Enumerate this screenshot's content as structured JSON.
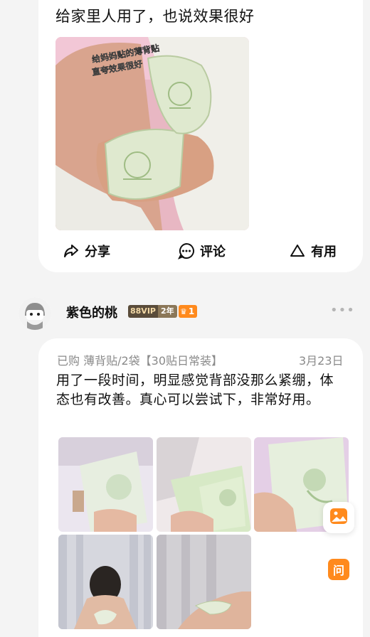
{
  "review1": {
    "text": "给家里人用了，也说效果很好",
    "photo_caption": "给妈妈贴的薄背贴 直夸效果很好"
  },
  "actions": {
    "share": "分享",
    "comment": "评论",
    "useful": "有用"
  },
  "reviewer": {
    "name": "紫色的桃",
    "vip": "88VIP",
    "years": "2年",
    "level": "1"
  },
  "review2": {
    "meta": "已购 薄背贴/2袋【30贴日常装】",
    "date": "3月23日",
    "text": "用了一段时间，明显感觉背部没那么紧绷，体态也有改善。真心可以尝试下，非常好用。"
  },
  "floating": {
    "ask": "问"
  },
  "colors": {
    "accent_orange": "#ff8a1d",
    "vip_dark": "#5a4c3a",
    "vip_light": "#8b7758",
    "muted": "#8a8a8a"
  }
}
